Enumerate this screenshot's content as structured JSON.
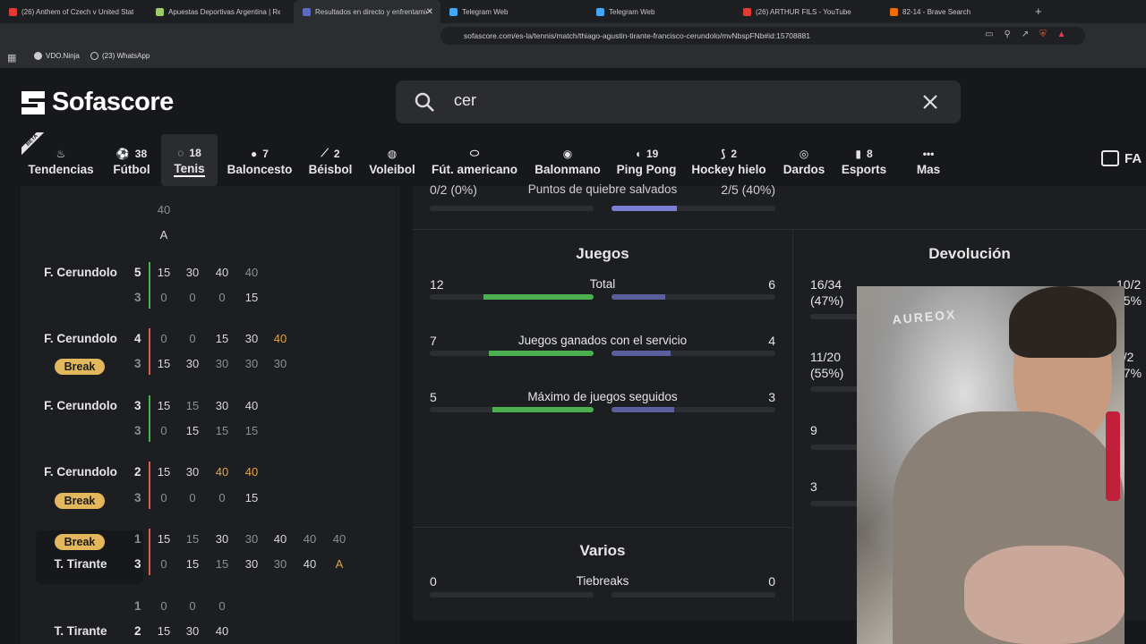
{
  "browser": {
    "tabs": [
      {
        "title": "(26) Anthem of Czech v United States",
        "color": "#e53935",
        "active": false
      },
      {
        "title": "Apuestas Deportivas Argentina | Regí",
        "color": "#9ccc65",
        "active": false
      },
      {
        "title": "Resultados en directo y enfrentamientos",
        "color": "#5c6bc0",
        "active": true
      },
      {
        "title": "Telegram Web",
        "color": "#42a5f5",
        "active": false
      },
      {
        "title": "Telegram Web",
        "color": "#42a5f5",
        "active": false
      },
      {
        "title": "(26) ARTHUR FILS - YouTube",
        "color": "#e53935",
        "active": false
      },
      {
        "title": "82-14 - Brave Search",
        "color": "#ef6c00",
        "active": false
      }
    ],
    "url": "sofascore.com/es-la/tennis/match/thiago-agustin-tirante-francisco-cerundolo/mvNbspFNb#id:15708881",
    "bookmarks": [
      "VDO.Ninja",
      "(23) WhatsApp"
    ]
  },
  "site": {
    "logo": "Sofascore",
    "search_value": "cer",
    "favs": "FA",
    "beta": "BETA"
  },
  "sports": [
    {
      "label": "Tendencias",
      "count": "",
      "icon": "flame-icon"
    },
    {
      "label": "Fútbol",
      "count": "38",
      "icon": "soccer-ball-icon"
    },
    {
      "label": "Tenis",
      "count": "18",
      "icon": "tennis-icon",
      "active": true
    },
    {
      "label": "Baloncesto",
      "count": "7",
      "icon": "basketball-icon"
    },
    {
      "label": "Béisbol",
      "count": "2",
      "icon": "baseball-icon"
    },
    {
      "label": "Voleibol",
      "count": "",
      "icon": "volleyball-icon"
    },
    {
      "label": "Fút. americano",
      "count": "",
      "icon": "football-icon"
    },
    {
      "label": "Balonmano",
      "count": "",
      "icon": "handball-icon"
    },
    {
      "label": "Ping Pong",
      "count": "19",
      "icon": "ping-pong-icon"
    },
    {
      "label": "Hockey hielo",
      "count": "2",
      "icon": "hockey-icon"
    },
    {
      "label": "Dardos",
      "count": "",
      "icon": "darts-icon"
    },
    {
      "label": "Esports",
      "count": "8",
      "icon": "esports-icon"
    },
    {
      "label": "Mas",
      "count": "",
      "icon": "more-icon"
    }
  ],
  "pbp": {
    "top": [
      "40",
      "A"
    ],
    "games": [
      {
        "p1": "F. Cerundolo",
        "s1": "5",
        "s2": "3",
        "pts1": [
          "15",
          "30",
          "40",
          "40"
        ],
        "pts2": [
          "0",
          "0",
          "0",
          "15"
        ],
        "dim1": [
          3
        ],
        "dim2": [
          0,
          1,
          2
        ],
        "ora1": [],
        "ora2": [],
        "bar": "green",
        "brk": ""
      },
      {
        "p1": "F. Cerundolo",
        "s1": "4",
        "s2": "3",
        "pts1": [
          "0",
          "0",
          "15",
          "30",
          "40"
        ],
        "pts2": [
          "15",
          "30",
          "30",
          "30",
          "30"
        ],
        "dim1": [
          0,
          1
        ],
        "dim2": [
          2,
          3,
          4
        ],
        "ora1": [
          4
        ],
        "ora2": [],
        "bar": "red",
        "brk": "Break"
      },
      {
        "p1": "F. Cerundolo",
        "s1": "3",
        "s2": "3",
        "pts1": [
          "15",
          "15",
          "30",
          "40"
        ],
        "pts2": [
          "0",
          "15",
          "15",
          "15"
        ],
        "dim1": [
          1
        ],
        "dim2": [
          0,
          2,
          3
        ],
        "ora1": [],
        "ora2": [],
        "bar": "green",
        "brk": ""
      },
      {
        "p1": "F. Cerundolo",
        "s1": "2",
        "s2": "3",
        "pts1": [
          "15",
          "30",
          "40",
          "40"
        ],
        "pts2": [
          "0",
          "0",
          "0",
          "15"
        ],
        "dim1": [],
        "dim2": [
          0,
          1,
          2
        ],
        "ora1": [
          2,
          3
        ],
        "ora2": [],
        "bar": "red",
        "brk": "Break"
      },
      {
        "p1": "Break",
        "p2": "T. Tirante",
        "s1": "1",
        "s2": "3",
        "pts1": [
          "15",
          "15",
          "30",
          "30",
          "40",
          "40",
          "40"
        ],
        "pts2": [
          "0",
          "15",
          "15",
          "30",
          "30",
          "40",
          "A"
        ],
        "dim1": [
          1,
          3,
          5,
          6
        ],
        "dim2": [
          0,
          2,
          4
        ],
        "ora1": [],
        "ora2": [
          6
        ],
        "bar": "red",
        "brk": "top"
      },
      {
        "p2": "T. Tirante",
        "s1": "1",
        "s2": "2",
        "pts1": [
          "0",
          "0",
          "0"
        ],
        "pts2": [
          "15",
          "30",
          "40"
        ],
        "dim1": [
          0,
          1,
          2
        ],
        "dim2": [],
        "ora1": [],
        "ora2": [],
        "bar": "",
        "brk": ""
      }
    ]
  },
  "stats": {
    "prev_row": {
      "left": "0/2 (0%)",
      "label": "Puntos de quiebre salvados",
      "right": "2/5 (40%)",
      "lf": 0.0,
      "rf": 0.4
    },
    "juegos": {
      "title": "Juegos",
      "rows": [
        {
          "left": "12",
          "label": "Total",
          "right": "6",
          "lf": 0.67,
          "rf": 0.33
        },
        {
          "left": "7",
          "label": "Juegos ganados con el servicio",
          "right": "4",
          "lf": 0.64,
          "rf": 0.36
        },
        {
          "left": "5",
          "label": "Máximo de juegos seguidos",
          "right": "3",
          "lf": 0.62,
          "rf": 0.38
        }
      ]
    },
    "devolucion": {
      "title": "Devolución",
      "rows": [
        {
          "left": "16/34",
          "left2": "(47%)",
          "right": "10/2",
          "right2": "35%"
        },
        {
          "left": "11/20",
          "left2": "(55%)",
          "right": "9/2",
          "right2": "37%"
        },
        {
          "left": "9",
          "left2": ""
        },
        {
          "left": "3",
          "left2": ""
        }
      ]
    },
    "varios": {
      "title": "Varios",
      "rows": [
        {
          "left": "0",
          "label": "Tiebreaks",
          "right": "0"
        }
      ]
    }
  },
  "colors": {
    "green": "#4caf50",
    "purple": "#5c5f9e",
    "bright_purple": "#7b7fd4",
    "break_bg": "#e3b85c",
    "red": "#e05a4f"
  }
}
